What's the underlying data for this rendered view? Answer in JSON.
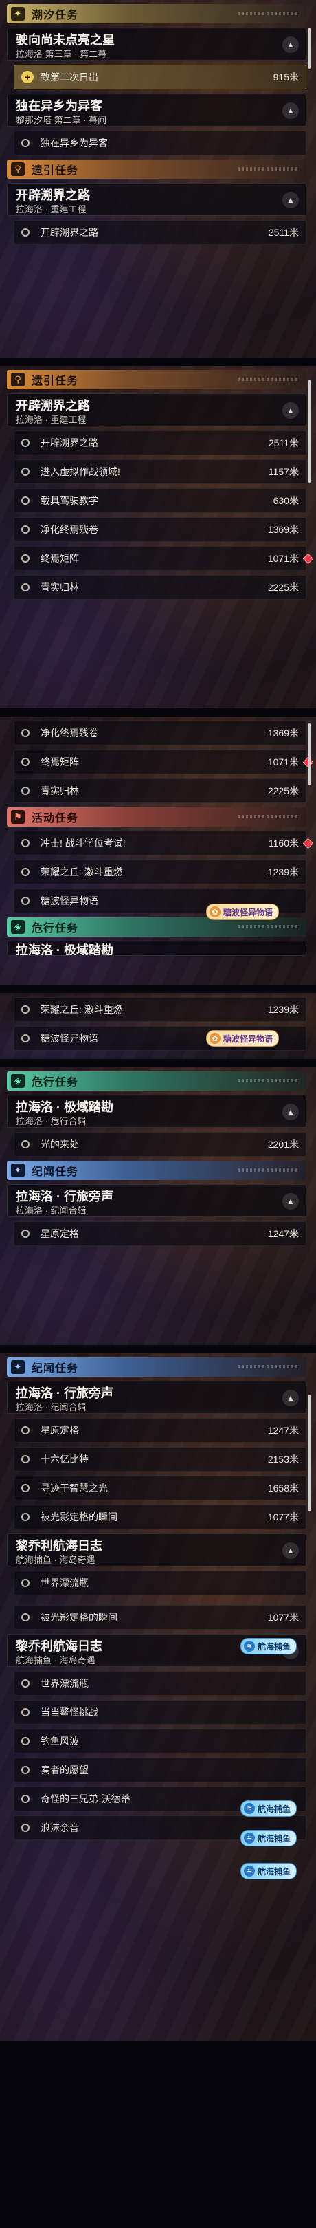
{
  "units": {
    "meters": "米"
  },
  "categories": {
    "main": "潮汐任务",
    "side": "遗引任务",
    "activity": "活动任务",
    "danger": "危行任务",
    "journal": "纪闻任务"
  },
  "chapters": {
    "c1": {
      "title": "驶向尚未点亮之星",
      "subtitle": "拉海洛 第三章 · 第二幕"
    },
    "c2": {
      "title": "独在异乡为异客",
      "subtitle": "黎那汐塔 第二章 · 幕间"
    },
    "c3": {
      "title": "开辟溯界之路",
      "subtitle": "拉海洛 · 重建工程"
    },
    "c4": {
      "title": "拉海洛 · 极域踏勘",
      "subtitle": "拉海洛 · 危行合辑"
    },
    "c5": {
      "title": "拉海洛 · 行旅旁声",
      "subtitle": "拉海洛 · 纪闻合辑"
    },
    "c6": {
      "title": "黎乔利航海日志",
      "subtitle": "航海捕鱼 · 海岛奇遇"
    }
  },
  "tasks": {
    "t_sunrise": {
      "name": "致第二次日出",
      "dist": "915米"
    },
    "t_alien": {
      "name": "独在异乡为异客",
      "dist": ""
    },
    "t_road": {
      "name": "开辟溯界之路",
      "dist": "2511米"
    },
    "t_virtual": {
      "name": "进入虚拟作战领域!",
      "dist": "1157米"
    },
    "t_vehicle": {
      "name": "载具驾驶教学",
      "dist": "630米"
    },
    "t_purify": {
      "name": "净化终焉残卷",
      "dist": "1369米"
    },
    "t_matrix": {
      "name": "终焉矩阵",
      "dist": "1071米"
    },
    "t_forest": {
      "name": "青实归林",
      "dist": "2225米"
    },
    "t_exam": {
      "name": "冲击! 战斗学位考试!",
      "dist": "1160米"
    },
    "t_glory": {
      "name": "荣耀之丘: 激斗重燃",
      "dist": "1239米"
    },
    "t_candy": {
      "name": "糖波怪异物语",
      "dist": ""
    },
    "t_light": {
      "name": "光的来处",
      "dist": "2201米"
    },
    "t_star": {
      "name": "星原定格",
      "dist": "1247米"
    },
    "t_16b": {
      "name": "十六亿比特",
      "dist": "2153米"
    },
    "t_wisdom": {
      "name": "寻迹于智慧之光",
      "dist": "1658米"
    },
    "t_frozen": {
      "name": "被光影定格的瞬间",
      "dist": "1077米"
    },
    "t_bottle": {
      "name": "世界漂流瓶",
      "dist": ""
    },
    "t_monster": {
      "name": "当当鳌怪挑战",
      "dist": ""
    },
    "t_fishing": {
      "name": "钓鱼风波",
      "dist": ""
    },
    "t_player": {
      "name": "奏者的愿望",
      "dist": ""
    },
    "t_brothers": {
      "name": "奇怪的三兄弟·沃德蒂",
      "dist": ""
    },
    "t_waves": {
      "name": "浪沫余音",
      "dist": ""
    }
  },
  "tags": {
    "candy": "糖波怪异物语",
    "sea": "航海捕鱼"
  },
  "icons": {
    "main": "plus-icon",
    "side": "map-pin-icon",
    "activity": "flag-icon",
    "danger": "danger-icon",
    "journal": "star-icon",
    "toggle": "chevron-up-icon",
    "alert": "alert-diamond-icon"
  }
}
